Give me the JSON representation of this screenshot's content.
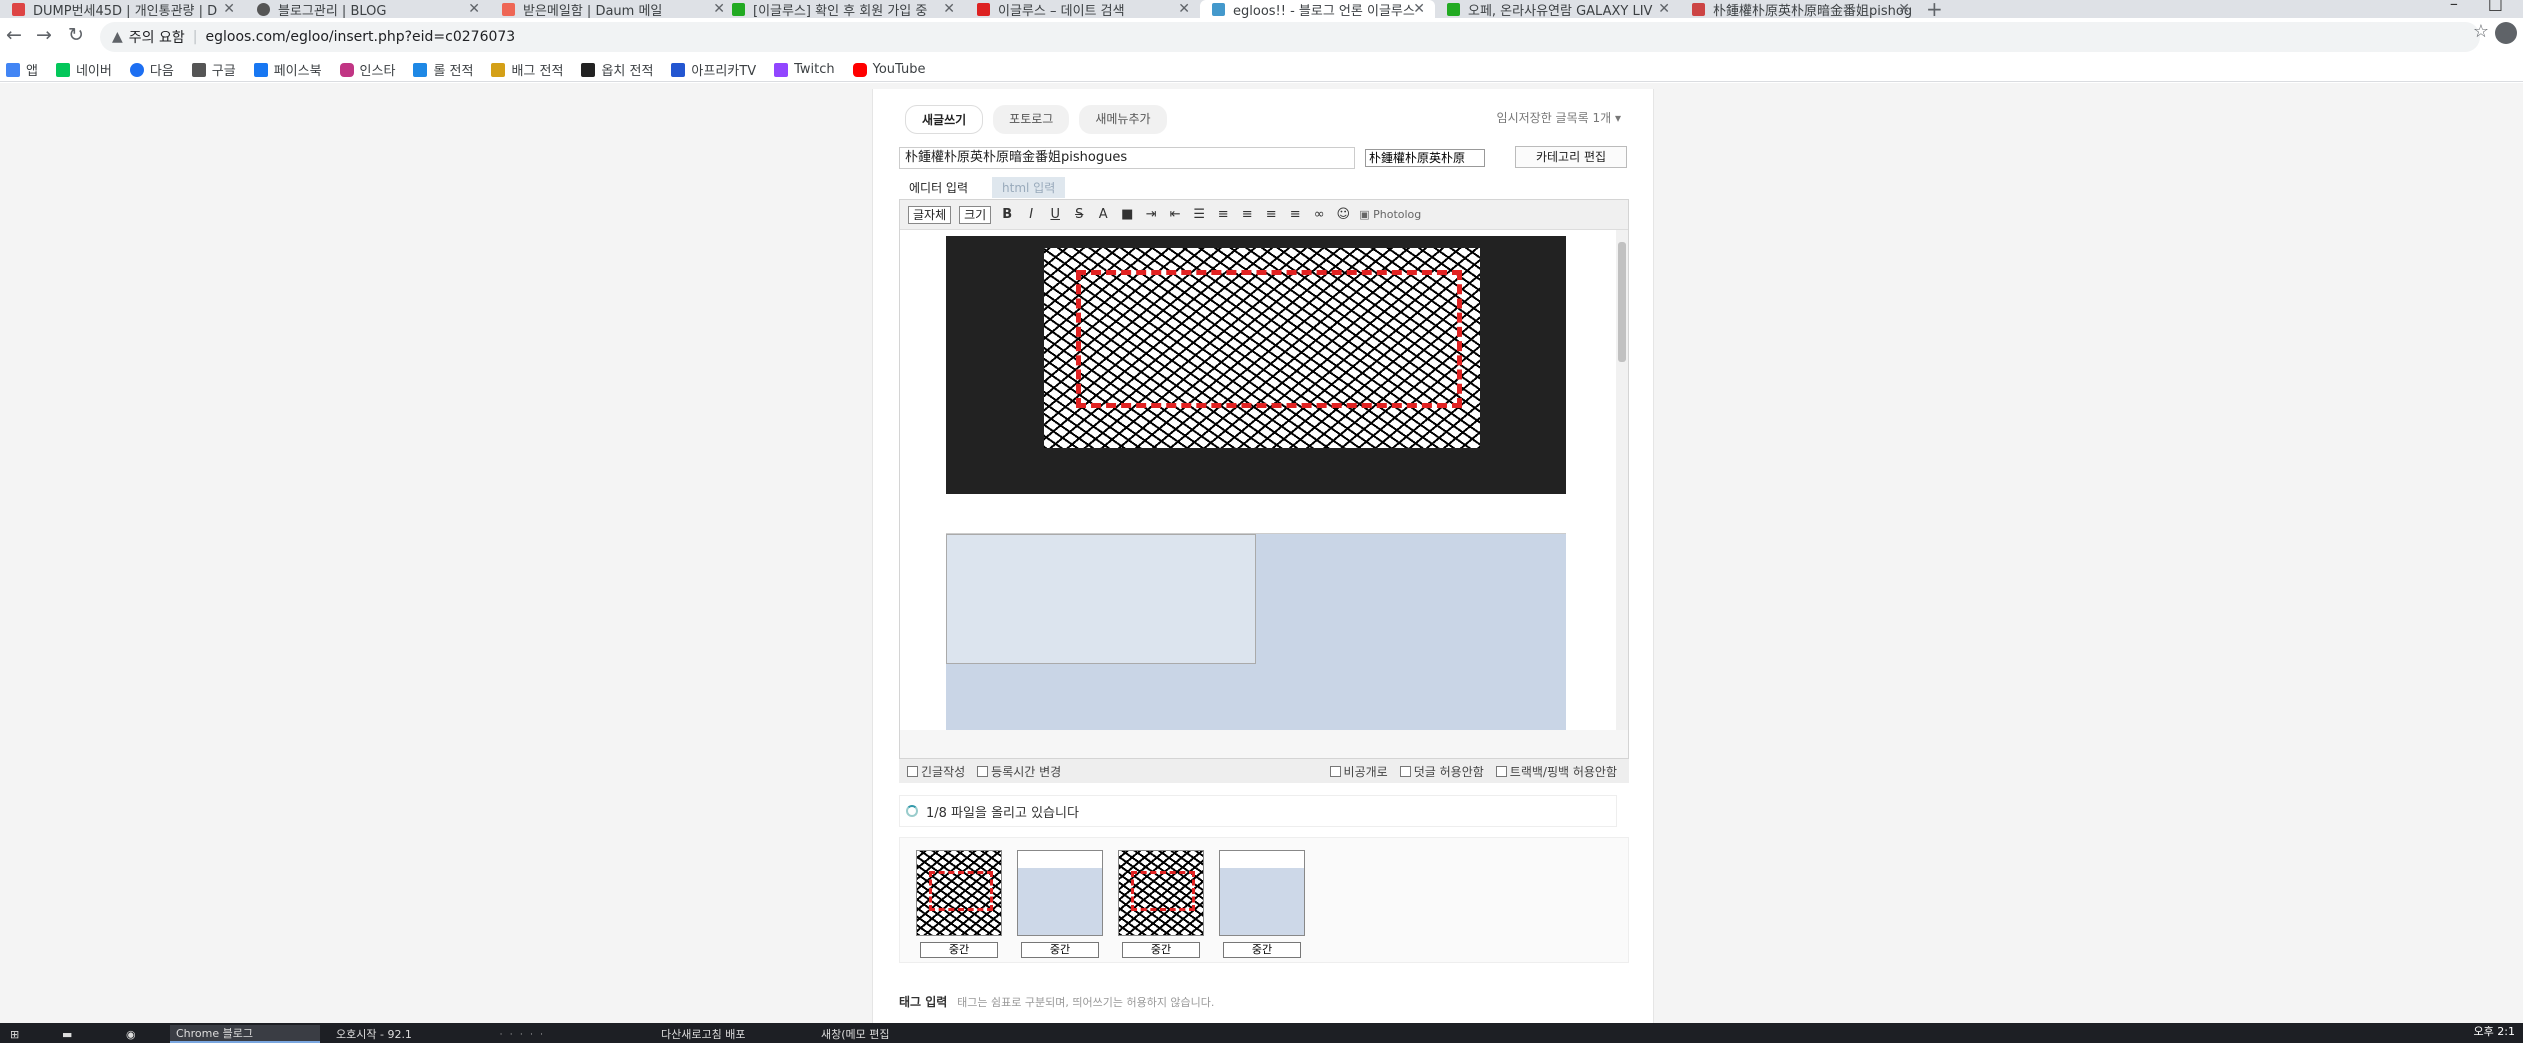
{
  "tabs": [
    {
      "label": "DUMP번세45D | 개인통관량 | D",
      "color": "#d44"
    },
    {
      "label": "블로그관리 | BLOG",
      "color": "#555"
    },
    {
      "label": "받은메일함 | Daum 메일",
      "color": "#e65"
    },
    {
      "label": "[이글루스] 확인 후 회원 가입 중",
      "color": "#2a2"
    },
    {
      "label": "이글루스 – 데이트 검색",
      "color": "#d22"
    },
    {
      "label": "egloos!! - 블로그 언론 이글루스",
      "color": "#49c"
    },
    {
      "label": "오페, 온라사유연람 GALAXY LIV",
      "color": "#2a2"
    },
    {
      "label": "朴鍾權朴原英朴原暗金番姐pishog",
      "color": "#c44"
    }
  ],
  "address": {
    "warning": "주의 요함",
    "url": "egloos.com/egloo/insert.php?eid=c0276073"
  },
  "bookmarks": [
    {
      "label": "앱",
      "color": "#4285f4"
    },
    {
      "label": "네이버",
      "color": "#03c75a"
    },
    {
      "label": "다음",
      "color": "#1d6ff2"
    },
    {
      "label": "구글",
      "color": "#555"
    },
    {
      "label": "페이스북",
      "color": "#1877f2"
    },
    {
      "label": "인스타",
      "color": "#c13584"
    },
    {
      "label": "롤 전적",
      "color": "#1e88e5"
    },
    {
      "label": "배그 전적",
      "color": "#d4a017"
    },
    {
      "label": "옵치 전적",
      "color": "#222"
    },
    {
      "label": "아프리카TV",
      "color": "#2356d1"
    },
    {
      "label": "Twitch",
      "color": "#9146ff"
    },
    {
      "label": "YouTube",
      "color": "#ff0000"
    }
  ],
  "editor": {
    "mode_tabs": [
      "새글쓰기",
      "포토로그",
      "새메뉴추가"
    ],
    "temp_saved": "임시저장한 글목록 1개 ▾",
    "title_value": "朴鍾權朴原英朴原暗金番姐pishogues",
    "category_value": "朴鍾權朴原英朴原",
    "category_edit": "카테고리 편집",
    "tab_editor": "에디터 입력",
    "tab_html": "html 입력",
    "font_select": "글자체",
    "size_select": "크기",
    "photolog": "Photolog",
    "options": [
      "긴글작성",
      "등록시간 변경",
      "비공개로",
      "덧글 허용안함",
      "트랙백/핑백 허용안함"
    ],
    "upload_status": "1/8 파일을 올리고 있습니다",
    "thumb_align": [
      "중간",
      "중간",
      "중간",
      "중간"
    ],
    "tag_label": "태그 입력",
    "tag_hint": "태그는 쉼표로 구분되며, 띄어쓰기는 허용하지 않습니다."
  },
  "taskbar": {
    "items": [
      "Chrome 블로그",
      "오호시작 - 92.1",
      "ᆞᆞᆞᆞᆞ",
      "다산새로고침 배포",
      "새창(메모 편집"
    ],
    "clock": "오후 2:1"
  }
}
